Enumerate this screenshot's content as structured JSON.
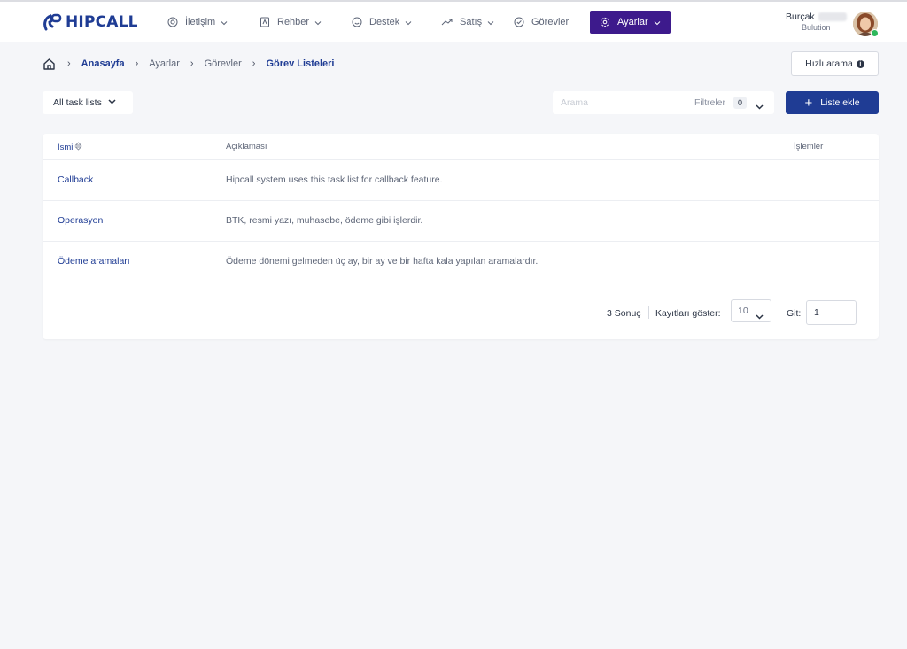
{
  "header": {
    "logo_text": "HIPCALL",
    "nav": [
      {
        "label": "İletişim",
        "icon": "at-sign-icon"
      },
      {
        "label": "Rehber",
        "icon": "contact-book-icon"
      },
      {
        "label": "Destek",
        "icon": "smile-icon"
      },
      {
        "label": "Satış",
        "icon": "trend-up-icon"
      },
      {
        "label": "Görevler",
        "icon": "check-circle-icon"
      },
      {
        "label": "Ayarlar",
        "icon": "gear-icon",
        "active": true
      }
    ],
    "user": {
      "name": "Burçak",
      "company": "Bulution",
      "status_color": "#2eb85c"
    },
    "accent_active": "#3d1a8c",
    "brand_color": "#1f3c94"
  },
  "breadcrumb": {
    "items": [
      "Anasayfa",
      "Ayarlar",
      "Görevler",
      "Görev Listeleri"
    ]
  },
  "quick_search": {
    "label": "Hızlı arama"
  },
  "toolbar": {
    "list_filter": "All task lists",
    "search_placeholder": "Arama",
    "filters_label": "Filtreler",
    "filters_count": "0",
    "add_button": "Liste ekle"
  },
  "table": {
    "columns": {
      "name": "İsmi",
      "description": "Açıklaması",
      "actions": "İşlemler"
    },
    "rows": [
      {
        "name": "Callback",
        "description": "Hipcall system uses this task list for callback feature."
      },
      {
        "name": "Operasyon",
        "description": "BTK, resmi yazı, muhasebe, ödeme gibi işlerdir."
      },
      {
        "name": "Ödeme aramaları",
        "description": "Ödeme dönemi gelmeden üç ay, bir ay ve bir hafta kala yapılan aramalardır."
      }
    ]
  },
  "pagination": {
    "result_count": "3 Sonuç",
    "show_label": "Kayıtları göster:",
    "page_size": "10",
    "goto_label": "Git:",
    "goto_value": "1"
  }
}
